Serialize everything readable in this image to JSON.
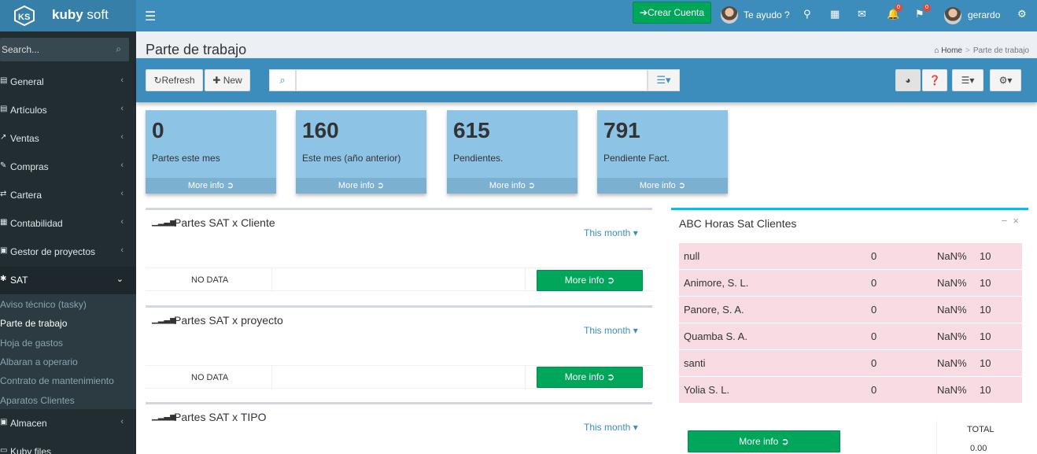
{
  "brand": {
    "name_bold": "kuby",
    "name_light": "soft"
  },
  "topbar": {
    "crear_cuenta": "Crear Cuenta",
    "help": "Te ayudo ?",
    "notif_badge": "0",
    "msg_badge": "0",
    "user": "gerardo"
  },
  "sidebar": {
    "search_placeholder": "Search...",
    "items": [
      {
        "label": "General",
        "icon": "gauge-icon"
      },
      {
        "label": "Artículos",
        "icon": "list-icon"
      },
      {
        "label": "Ventas",
        "icon": "external-link-icon"
      },
      {
        "label": "Compras",
        "icon": "edit-icon"
      },
      {
        "label": "Cartera",
        "icon": "exchange-icon"
      },
      {
        "label": "Contabilidad",
        "icon": "calculator-icon"
      },
      {
        "label": "Gestor de proyectos",
        "icon": "suitcase-icon"
      },
      {
        "label": "SAT",
        "icon": "wrench-icon"
      }
    ],
    "sat_sub": [
      "Aviso técnico (tasky)",
      "Parte de trabajo",
      "Hoja de gastos",
      "Albaran a operario",
      "Contrato de mantenimiento",
      "Aparatos Clientes"
    ],
    "after": [
      {
        "label": "Almacen",
        "icon": "box-icon"
      },
      {
        "label": "Kuby files",
        "icon": "folder-icon"
      }
    ]
  },
  "header": {
    "title": "Parte de trabajo",
    "crumb_home": "Home",
    "crumb_current": "Parte de trabajo"
  },
  "toolbar": {
    "refresh": "Refresh",
    "new": "New",
    "search_value": ""
  },
  "infoboxes": [
    {
      "value": "0",
      "label": "Partes este mes",
      "more": "More info"
    },
    {
      "value": "160",
      "label": "Este mes (año anterior)",
      "more": "More info"
    },
    {
      "value": "615",
      "label": "Pendientes.",
      "more": "More info"
    },
    {
      "value": "791",
      "label": "Pendiente Fact.",
      "more": "More info"
    }
  ],
  "panels": [
    {
      "title": "Partes SAT x Cliente",
      "period": "This month",
      "nodata": "NO DATA",
      "more": "More info"
    },
    {
      "title": "Partes SAT x proyecto",
      "period": "This month",
      "nodata": "NO DATA",
      "more": "More info"
    },
    {
      "title": "Partes SAT x TIPO",
      "period": "This month"
    }
  ],
  "abc": {
    "title": "ABC Horas Sat Clientes",
    "rows": [
      {
        "name": "null",
        "hours": "0",
        "pct": "NaN%",
        "n": "10"
      },
      {
        "name": "Animore, S. L.",
        "hours": "0",
        "pct": "NaN%",
        "n": "10"
      },
      {
        "name": "Panore, S. A.",
        "hours": "0",
        "pct": "NaN%",
        "n": "10"
      },
      {
        "name": "Quamba S. A.",
        "hours": "0",
        "pct": "NaN%",
        "n": "10"
      },
      {
        "name": "santi",
        "hours": "0",
        "pct": "NaN%",
        "n": "10"
      },
      {
        "name": "Yolia S. L.",
        "hours": "0",
        "pct": "NaN%",
        "n": "10"
      }
    ],
    "more": "More info",
    "total_label": "TOTAL",
    "total_value": "0.00"
  }
}
